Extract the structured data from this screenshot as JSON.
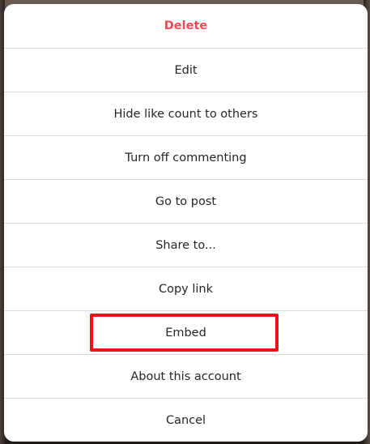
{
  "menu": {
    "items": [
      {
        "label": "Delete",
        "variant": "danger"
      },
      {
        "label": "Edit"
      },
      {
        "label": "Hide like count to others"
      },
      {
        "label": "Turn off commenting"
      },
      {
        "label": "Go to post"
      },
      {
        "label": "Share to..."
      },
      {
        "label": "Copy link"
      },
      {
        "label": "Embed",
        "highlighted": true
      },
      {
        "label": "About this account"
      },
      {
        "label": "Cancel"
      }
    ]
  },
  "colors": {
    "danger": "#ed4956",
    "highlight_outline": "#e8141a",
    "divider": "#dbdbdb",
    "text": "#262626"
  }
}
